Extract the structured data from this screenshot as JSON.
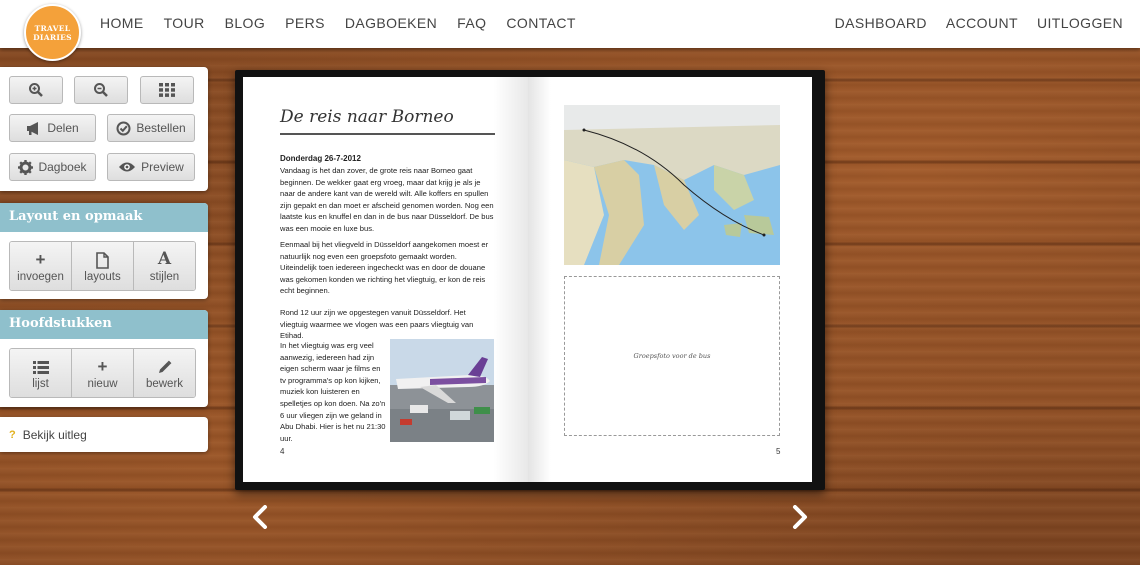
{
  "logo": {
    "line1": "TRAVEL",
    "line2": "DIARIES"
  },
  "nav": {
    "left": [
      "HOME",
      "TOUR",
      "BLOG",
      "PERS",
      "DAGBOEKEN",
      "FAQ",
      "CONTACT"
    ],
    "right": [
      "DASHBOARD",
      "ACCOUNT",
      "UITLOGGEN"
    ]
  },
  "tools": {
    "delen": "Delen",
    "bestellen": "Bestellen",
    "dagboek": "Dagboek",
    "preview": "Preview"
  },
  "layout_panel": {
    "title": "Layout en opmaak",
    "buttons": [
      "invoegen",
      "layouts",
      "stijlen"
    ]
  },
  "chapters_panel": {
    "title": "Hoofdstukken",
    "buttons": [
      "lijst",
      "nieuw",
      "bewerk"
    ]
  },
  "help": {
    "label": "Bekijk uitleg"
  },
  "book": {
    "left_page": {
      "title": "De reis naar Borneo",
      "date": "Donderdag 26-7-2012",
      "p1": "Vandaag is het dan zover, de grote reis naar Borneo gaat beginnen. De wekker gaat erg vroeg, maar dat krijg je als je naar de andere kant van de wereld wilt. Alle koffers en spullen zijn gepakt en dan moet er afscheid genomen worden. Nog een laatste kus en knuffel en dan in de bus naar Düsseldorf. De bus was een mooie en luxe bus.",
      "p2": "Eenmaal bij het vliegveld in Düsseldorf aangekomen moest er natuurlijk nog even een groepsfoto gemaakt worden. Uiteindelijk toen iedereen ingecheckt was en door de douane was gekomen konden we richting het vliegtuig, er kon de reis echt beginnen.",
      "p3": "Rond 12 uur zijn we opgestegen vanuit Düsseldorf. Het vliegtuig waarmee we vlogen was een paars vliegtuig van Etihad.",
      "p4": "In het vliegtuig was erg veel aanwezig, iedereen had zijn eigen scherm waar je films en tv programma's op kon kijken, muziek kon luisteren en spelletjes op kon doen. Na zo'n 6 uur vliegen zijn we geland in Abu Dhabi. Hier is het nu 21:30 uur.",
      "page_number": "4"
    },
    "right_page": {
      "placeholder_text": "Groepsfoto voor de bus",
      "page_number": "5"
    }
  }
}
